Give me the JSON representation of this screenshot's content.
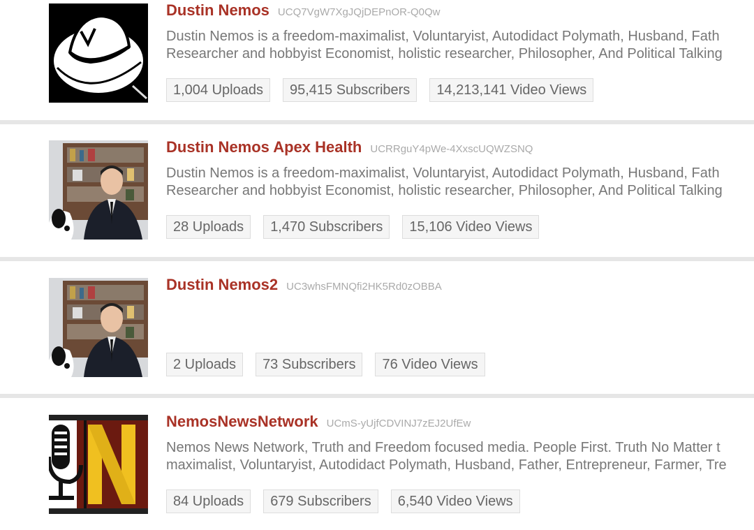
{
  "channels": [
    {
      "name": "Dustin Nemos",
      "id": "UCQ7VgW7XgJQjDEPnOR-Q0Qw",
      "avatar": "white-fedora-hat-logo",
      "description_line1": "Dustin Nemos is a freedom-maximalist, Voluntaryist, Autodidact Polymath, Husband, Fath",
      "description_line2": "Researcher and hobbyist Economist, holistic researcher, Philosopher, And Political Talking",
      "uploads": "1,004 Uploads",
      "subscribers": "95,415 Subscribers",
      "views": "14,213,141 Video Views"
    },
    {
      "name": "Dustin Nemos Apex Health",
      "id": "UCRRguY4pWe-4XxscUQWZSNQ",
      "avatar": "man-in-suit-bookshelf-photo",
      "description_line1": "Dustin Nemos is a freedom-maximalist, Voluntaryist, Autodidact Polymath, Husband, Fath",
      "description_line2": "Researcher and hobbyist Economist, holistic researcher, Philosopher, And Political Talking",
      "uploads": "28 Uploads",
      "subscribers": "1,470 Subscribers",
      "views": "15,106 Video Views"
    },
    {
      "name": "Dustin Nemos2",
      "id": "UC3whsFMNQfi2HK5Rd0zOBBA",
      "avatar": "man-in-suit-bookshelf-photo",
      "description_line1": "",
      "description_line2": "",
      "uploads": "2 Uploads",
      "subscribers": "73 Subscribers",
      "views": "76 Video Views"
    },
    {
      "name": "NemosNewsNetwork",
      "id": "UCmS-yUjfCDVINJ7zEJ2UfEw",
      "avatar": "microphone-n-logo",
      "description_line1": "Nemos News Network, Truth and Freedom focused media. People First. Truth No Matter t",
      "description_line2": "maximalist, Voluntaryist, Autodidact Polymath, Husband, Father, Entrepreneur, Farmer, Tre",
      "uploads": "84 Uploads",
      "subscribers": "679 Subscribers",
      "views": "6,540 Video Views"
    }
  ],
  "colors": {
    "channel_name": "#a93226",
    "channel_id": "#aaaaaa",
    "description": "#777777",
    "stat_text": "#666666",
    "stat_bg": "#f5f5f5",
    "divider": "#e6e6e6"
  }
}
